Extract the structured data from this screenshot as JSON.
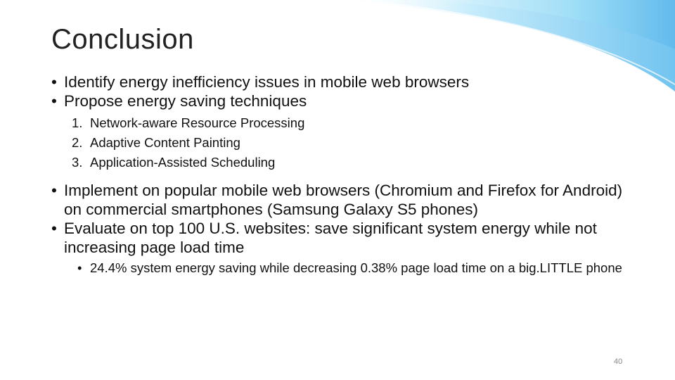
{
  "slide": {
    "title": "Conclusion",
    "bullets": [
      "Identify energy inefficiency issues in mobile web browsers",
      "Propose energy saving techniques"
    ],
    "techniques": [
      {
        "num": "1.",
        "text": "Network-aware Resource Processing"
      },
      {
        "num": "2.",
        "text": "Adaptive Content Painting"
      },
      {
        "num": "3.",
        "text": "Application-Assisted Scheduling"
      }
    ],
    "bullets2": [
      "Implement on popular mobile web browsers (Chromium and Firefox for Android) on commercial smartphones (Samsung Galaxy S5 phones)",
      "Evaluate on top 100 U.S. websites: save significant system energy while not increasing page load time"
    ],
    "sub_bullet": "24.4% system energy saving while decreasing 0.38% page load time on a big.LITTLE phone",
    "bullet_char": "•",
    "page_number": "40",
    "accent_color": "#7cc8f0"
  }
}
